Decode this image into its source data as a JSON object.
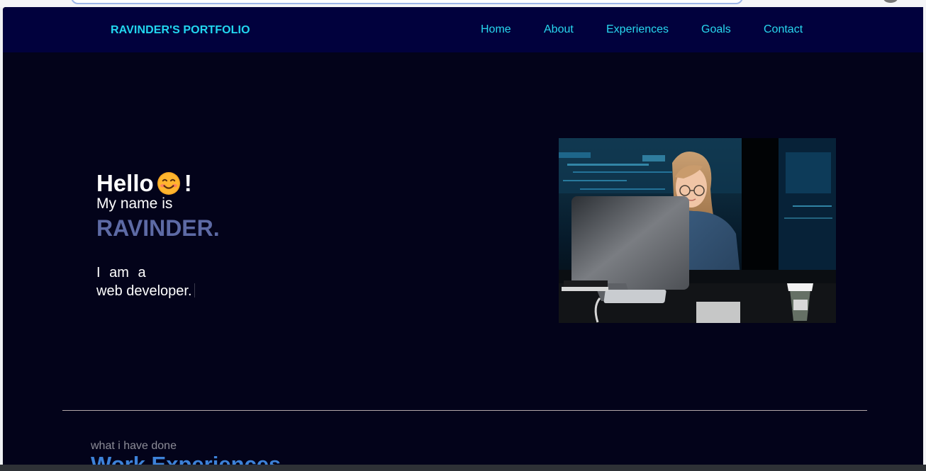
{
  "navbar": {
    "brand": "RAVINDER'S PORTFOLIO",
    "links": [
      "Home",
      "About",
      "Experiences",
      "Goals",
      "Contact"
    ]
  },
  "hero": {
    "greeting": "Hello",
    "exclamation": "!",
    "emoji_icon": "smiling-face-icon",
    "name_intro": "My name is",
    "name": "RAVINDER.",
    "iam": "I am a",
    "role": "web developer."
  },
  "experiences": {
    "subtitle": "what i have done",
    "title": "Work Experiences"
  },
  "colors": {
    "nav_bg": "#01013d",
    "page_bg": "#03031a",
    "nav_text": "#28d8ef",
    "name": "#5d6aa5",
    "section_title": "#3d82d8"
  }
}
